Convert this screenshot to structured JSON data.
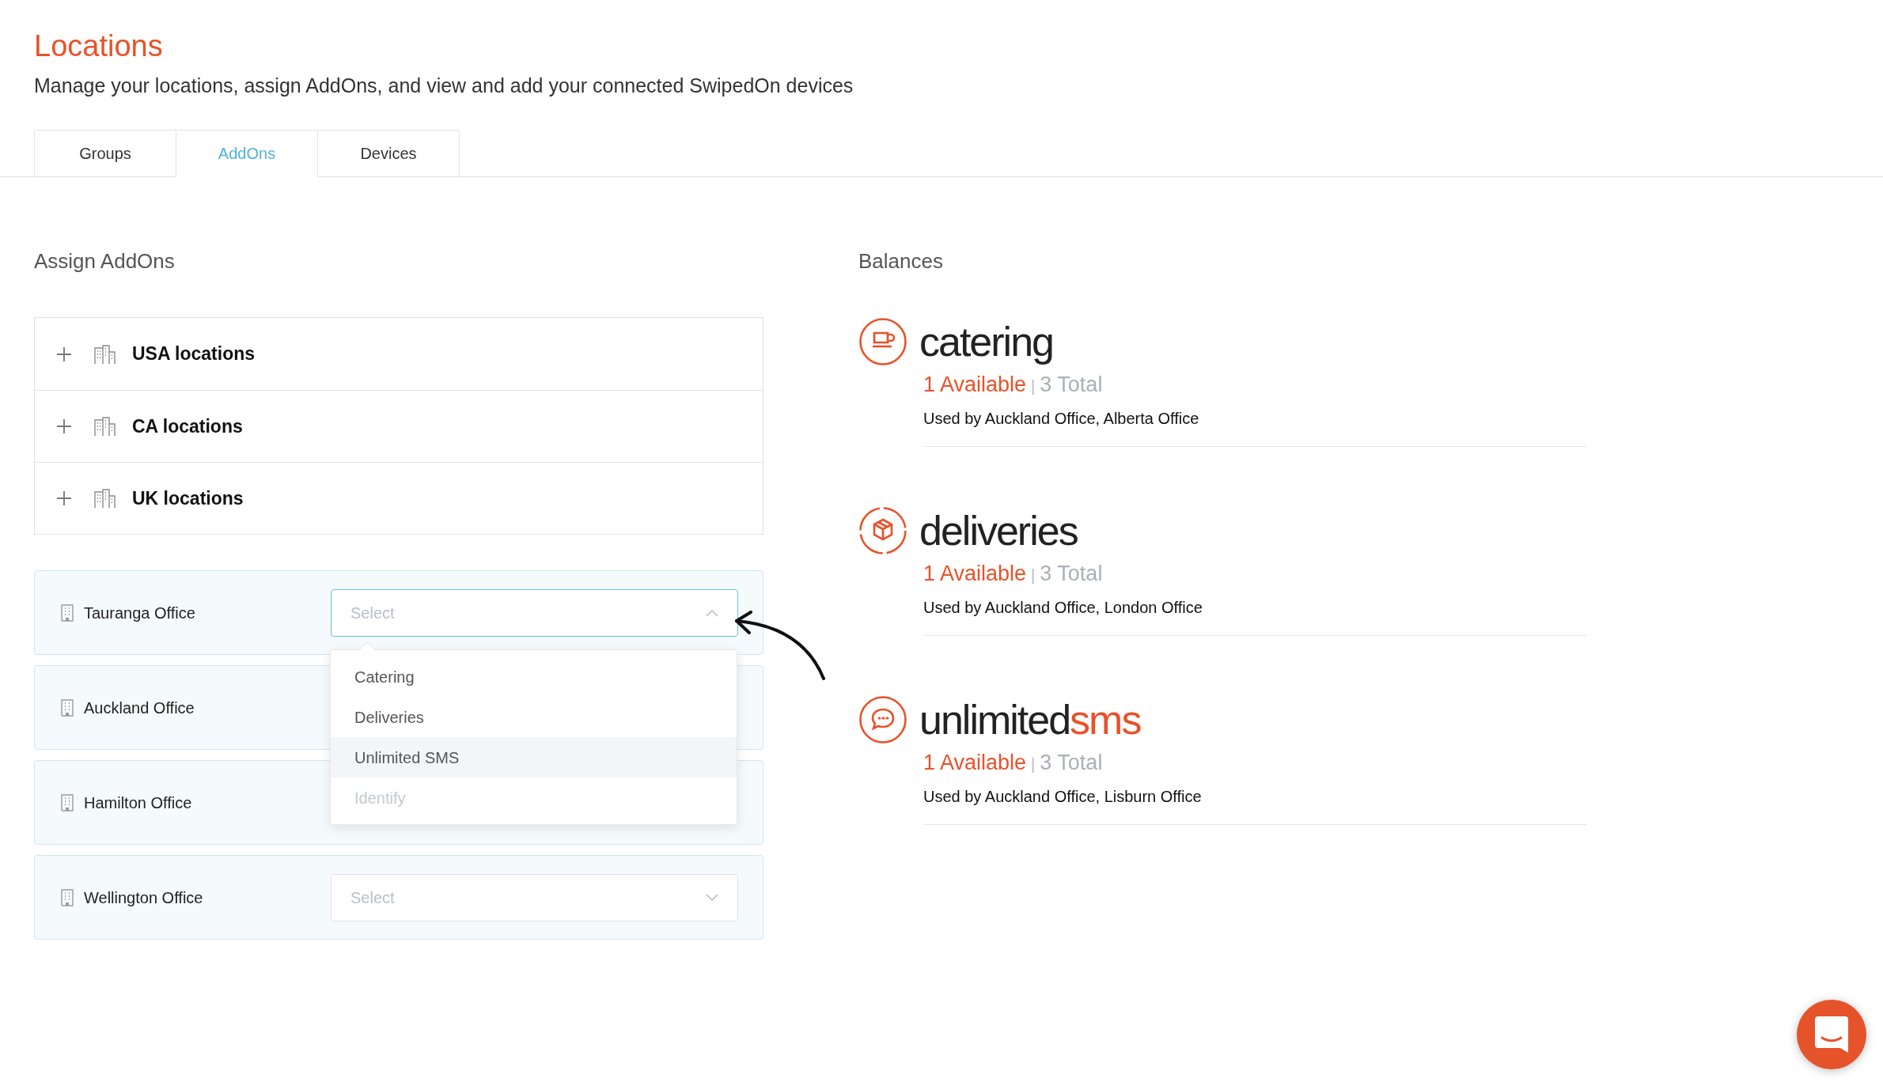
{
  "page": {
    "title": "Locations",
    "subtitle": "Manage your locations, assign AddOns, and view and add your connected SwipedOn devices"
  },
  "tabs": [
    {
      "label": "Groups",
      "selected": false
    },
    {
      "label": "AddOns",
      "selected": true
    },
    {
      "label": "Devices",
      "selected": false
    }
  ],
  "assign": {
    "heading": "Assign AddOns",
    "groups": [
      {
        "label": "USA locations",
        "expanded": false
      },
      {
        "label": "CA locations",
        "expanded": false
      },
      {
        "label": "UK locations",
        "expanded": false
      }
    ],
    "offices": [
      {
        "name": "Tauranga Office",
        "select": {
          "placeholder": "Select",
          "open": true,
          "options": [
            {
              "label": "Catering",
              "highlighted": false,
              "disabled": false
            },
            {
              "label": "Deliveries",
              "highlighted": false,
              "disabled": false
            },
            {
              "label": "Unlimited SMS",
              "highlighted": true,
              "disabled": false
            },
            {
              "label": "Identify",
              "highlighted": false,
              "disabled": true
            }
          ]
        }
      },
      {
        "name": "Auckland Office"
      },
      {
        "name": "Hamilton Office"
      },
      {
        "name": "Wellington Office",
        "select": {
          "placeholder": "Select",
          "open": false
        }
      }
    ]
  },
  "balances": {
    "heading": "Balances",
    "addons": [
      {
        "kind": "cup",
        "name": "catering",
        "available": "1 Available",
        "separator": "|",
        "total": "3 Total",
        "used_by": "Used by Auckland Office, Alberta Office"
      },
      {
        "kind": "box",
        "name": "deliveries",
        "available": "1 Available",
        "separator": "|",
        "total": "3 Total",
        "used_by": "Used by Auckland Office, London Office"
      },
      {
        "kind": "chat",
        "name": "unlimited",
        "name_accent": "sms",
        "available": "1 Available",
        "separator": "|",
        "total": "3 Total",
        "used_by": "Used by Auckland Office, Lisburn Office"
      }
    ]
  }
}
